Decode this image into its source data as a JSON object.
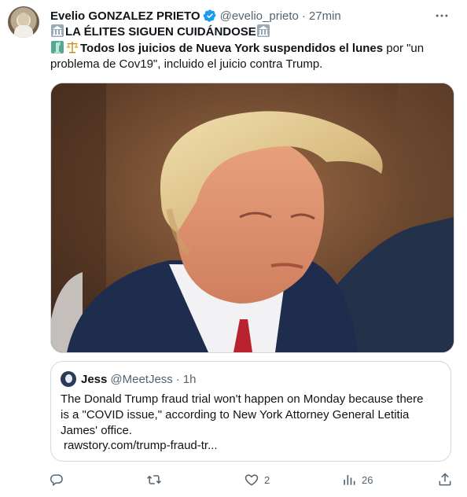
{
  "author": {
    "name": "Evelio GONZALEZ PRIETO",
    "handle": "@evelio_prieto",
    "separator": "·",
    "time": "27min"
  },
  "tweet": {
    "line1": "LA ÉLITES SIGUEN CUIDÁNDOSE",
    "line2_bold": "Todos los juicios de Nueva York suspendidos el lunes",
    "line2_rest": " por \"un",
    "line3": "problema de Cov19\", incluido el juicio contra Trump."
  },
  "quoted": {
    "name": "Jess",
    "handle": "@MeetJess",
    "separator": "·",
    "time": "1h",
    "lines": [
      "The Donald Trump fraud trial won't happen on Monday because there",
      "is a \"COVID issue,\" according to New York Attorney General Letitia",
      "James' office."
    ],
    "link": "rawstory.com/trump-fraud-tr..."
  },
  "actions": {
    "reply_count": "",
    "retweet_count": "",
    "like_count": "2",
    "views_count": "26"
  },
  "colors": {
    "verified": "#1d9bf0",
    "secondary_text": "#536471",
    "border": "#cfd9de"
  },
  "icons": [
    "more-icon",
    "verified-badge-icon",
    "classical-building-icon",
    "statue-of-liberty-icon",
    "scales-icon",
    "reply-icon",
    "retweet-icon",
    "like-icon",
    "views-icon",
    "share-icon"
  ]
}
